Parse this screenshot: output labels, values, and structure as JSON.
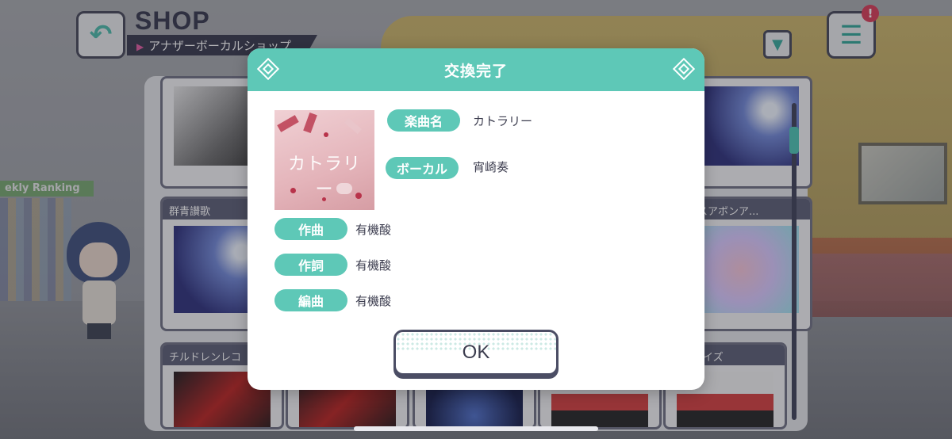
{
  "header": {
    "title": "SHOP",
    "subtitle": "アナザーボーカルショップ"
  },
  "background": {
    "ranking_sign": "ekly Ranking"
  },
  "cards": [
    {
      "title": ""
    },
    {
      "title": ""
    },
    {
      "title": "群青讃歌"
    },
    {
      "title": "スアボンア..."
    },
    {
      "title": "チルドレンレコ"
    },
    {
      "title": "ロウデイズ"
    }
  ],
  "dialog": {
    "title": "交換完了",
    "jacket_text": "カトラリー",
    "song_label": "楽曲名",
    "song_value": "カトラリー",
    "vocal_label": "ボーカル",
    "vocal_value": "宵崎奏",
    "composer_label": "作曲",
    "composer_value": "有機酸",
    "lyricist_label": "作詞",
    "lyricist_value": "有機酸",
    "arranger_label": "編曲",
    "arranger_value": "有機酸",
    "ok_label": "OK"
  },
  "badges": {
    "menu_alert": "!"
  },
  "colors": {
    "accent": "#5ec8b7",
    "dark": "#3c3d4f",
    "alert": "#d73a55"
  }
}
